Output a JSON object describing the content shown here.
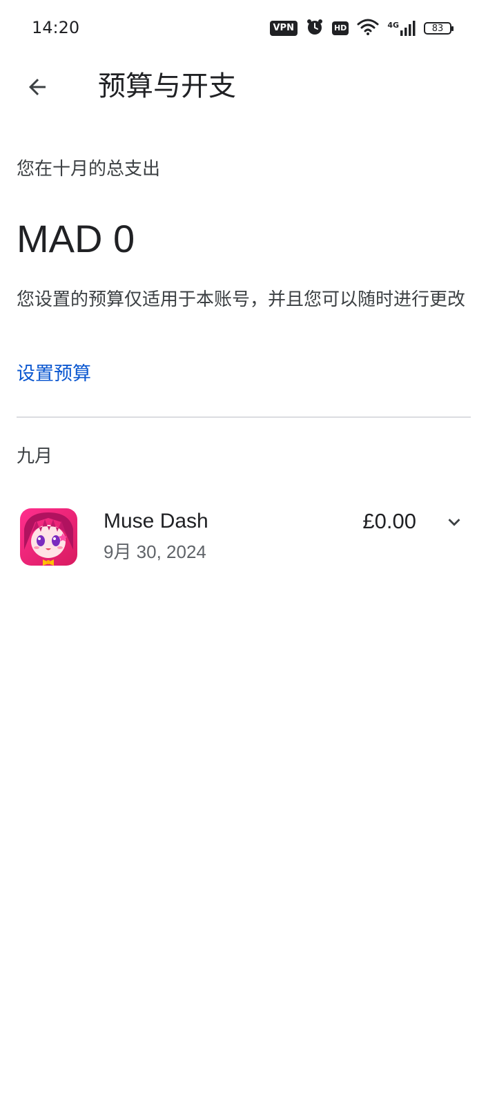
{
  "status_bar": {
    "time": "14:20",
    "vpn_label": "VPN",
    "hd_label": "HD",
    "network_label": "4G",
    "battery_level": "83",
    "icons": [
      "vpn-icon",
      "alarm-icon",
      "hd-icon",
      "wifi-icon",
      "signal-icon",
      "battery-icon"
    ]
  },
  "app_bar": {
    "title": "预算与开支",
    "back_icon": "arrow-left-icon"
  },
  "summary": {
    "month_label": "您在十月的总支出",
    "total": "MAD 0",
    "note": "您设置的预算仅适用于本账号，并且您可以随时进行更改",
    "set_budget_link": "设置预算",
    "link_color": "#0b57d0"
  },
  "history": {
    "section_title": "九月",
    "items": [
      {
        "app_name": "Muse Dash",
        "date": "9月 30, 2024",
        "price": "£0.00",
        "icon": "muse-dash-app-icon",
        "expand_icon": "chevron-down-icon"
      }
    ]
  }
}
